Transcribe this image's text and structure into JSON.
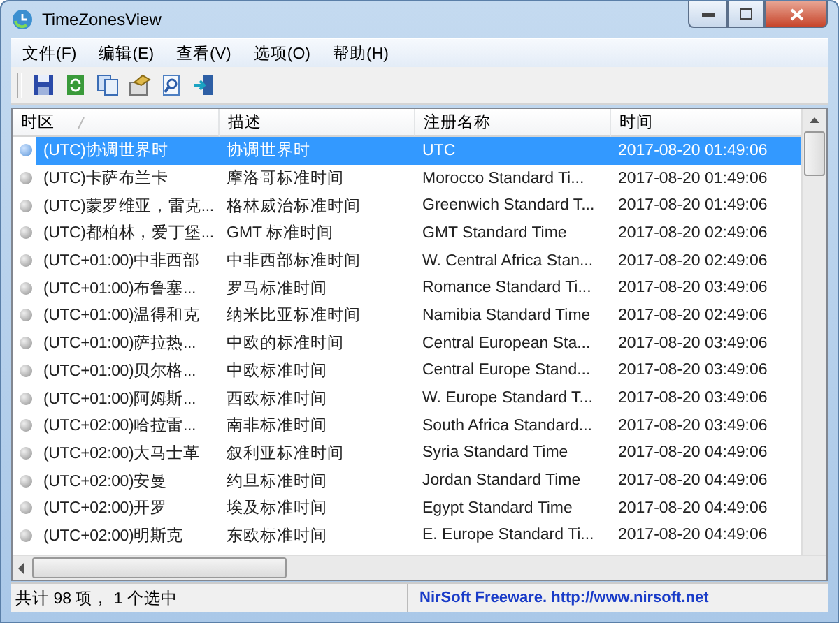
{
  "window": {
    "title": "TimeZonesView"
  },
  "menu": [
    "文件(F)",
    "编辑(E)",
    "查看(V)",
    "选项(O)",
    "帮助(H)"
  ],
  "toolbar": [
    {
      "kind": "save"
    },
    {
      "kind": "refresh"
    },
    {
      "kind": "copy"
    },
    {
      "kind": "properties"
    },
    {
      "kind": "find"
    },
    {
      "kind": "exit"
    }
  ],
  "table": {
    "columns": [
      {
        "label": "时区",
        "sorted": true
      },
      {
        "label": "描述",
        "sorted": false
      },
      {
        "label": "注册名称",
        "sorted": false
      },
      {
        "label": "时间",
        "sorted": false
      }
    ],
    "rows": [
      {
        "selected": true,
        "cells": [
          "(UTC)协调世界时",
          "协调世界时",
          "UTC",
          "2017-08-20 01:49:06"
        ]
      },
      {
        "selected": false,
        "cells": [
          "(UTC)卡萨布兰卡",
          "摩洛哥标准时间",
          "Morocco Standard Ti...",
          "2017-08-20 01:49:06"
        ]
      },
      {
        "selected": false,
        "cells": [
          "(UTC)蒙罗维亚，雷克...",
          "格林威治标准时间",
          "Greenwich Standard T...",
          "2017-08-20 01:49:06"
        ]
      },
      {
        "selected": false,
        "cells": [
          "(UTC)都柏林，爱丁堡...",
          "GMT 标准时间",
          "GMT Standard Time",
          "2017-08-20 02:49:06"
        ]
      },
      {
        "selected": false,
        "cells": [
          "(UTC+01:00)中非西部",
          "中非西部标准时间",
          "W. Central Africa Stan...",
          "2017-08-20 02:49:06"
        ]
      },
      {
        "selected": false,
        "cells": [
          "(UTC+01:00)布鲁塞...",
          "罗马标准时间",
          "Romance Standard Ti...",
          "2017-08-20 03:49:06"
        ]
      },
      {
        "selected": false,
        "cells": [
          "(UTC+01:00)温得和克",
          "纳米比亚标准时间",
          "Namibia Standard Time",
          "2017-08-20 02:49:06"
        ]
      },
      {
        "selected": false,
        "cells": [
          "(UTC+01:00)萨拉热...",
          "中欧的标准时间",
          "Central European Sta...",
          "2017-08-20 03:49:06"
        ]
      },
      {
        "selected": false,
        "cells": [
          "(UTC+01:00)贝尔格...",
          "中欧标准时间",
          "Central Europe Stand...",
          "2017-08-20 03:49:06"
        ]
      },
      {
        "selected": false,
        "cells": [
          "(UTC+01:00)阿姆斯...",
          "西欧标准时间",
          "W. Europe Standard T...",
          "2017-08-20 03:49:06"
        ]
      },
      {
        "selected": false,
        "cells": [
          "(UTC+02:00)哈拉雷...",
          "南非标准时间",
          "South Africa Standard...",
          "2017-08-20 03:49:06"
        ]
      },
      {
        "selected": false,
        "cells": [
          "(UTC+02:00)大马士革",
          "叙利亚标准时间",
          "Syria Standard Time",
          "2017-08-20 04:49:06"
        ]
      },
      {
        "selected": false,
        "cells": [
          "(UTC+02:00)安曼",
          "约旦标准时间",
          "Jordan Standard Time",
          "2017-08-20 04:49:06"
        ]
      },
      {
        "selected": false,
        "cells": [
          "(UTC+02:00)开罗",
          "埃及标准时间",
          "Egypt Standard Time",
          "2017-08-20 04:49:06"
        ]
      },
      {
        "selected": false,
        "cells": [
          "(UTC+02:00)明斯克",
          "东欧标准时间",
          "E. Europe Standard Ti...",
          "2017-08-20 04:49:06"
        ]
      }
    ]
  },
  "status_bar": {
    "count": "共计 98 项， 1 个选中",
    "credit": "NirSoft Freeware.  http://www.nirsoft.net"
  }
}
